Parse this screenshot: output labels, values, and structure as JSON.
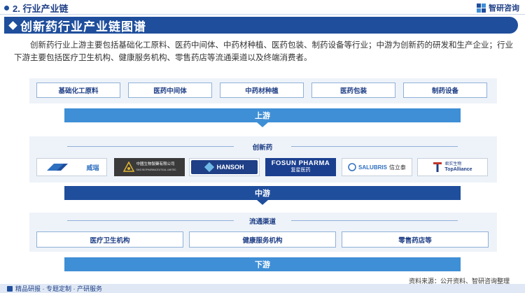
{
  "header": {
    "section_label": "2. 行业产业链",
    "brand": "智研咨询"
  },
  "title": "创新药行业产业链图谱",
  "intro": "创新药行业上游主要包括基础化工原料、医药中间体、中药材种植、医药包装、制药设备等行业；中游为创新药的研发和生产企业；行业下游主要包括医疗卫生机构、健康服务机构、零售药店等流通渠道以及终端消费者。",
  "upstream": {
    "items": [
      "基础化工原料",
      "医药中间体",
      "中药材种植",
      "医药包装",
      "制药设备"
    ],
    "arrow_label": "上游"
  },
  "midstream": {
    "band_title": "创新药",
    "logos": [
      {
        "name": "company-logo-1",
        "text": "威瑞"
      },
      {
        "name": "company-logo-sino-biopharm",
        "text": "中國生物製藥有限公司",
        "subtext": "SINO BIOPHARMACEUTICAL LIMITED"
      },
      {
        "name": "company-logo-hansoh",
        "text": "HANSOH"
      },
      {
        "name": "company-logo-fosun",
        "text": "FOSUN PHARMA",
        "subtext": "复星医药"
      },
      {
        "name": "company-logo-salubris",
        "text": "SALUBRIS",
        "subtext": "信立泰"
      },
      {
        "name": "company-logo-topalliance",
        "text": "君实生物",
        "subtext": "TopAlliance"
      }
    ],
    "arrow_label": "中游"
  },
  "downstream": {
    "band_title": "流通渠道",
    "items": [
      "医疗卫生机构",
      "健康服务机构",
      "零售药店等"
    ],
    "arrow_label": "下游"
  },
  "footer": {
    "left": "精品研报 · 专题定制 · 产研服务",
    "source": "资料来源：公开资料、智研咨询整理"
  },
  "colors": {
    "primary": "#1f4e9c",
    "arrow_light": "#3f8fd6",
    "band_bg": "#eef3f9"
  }
}
